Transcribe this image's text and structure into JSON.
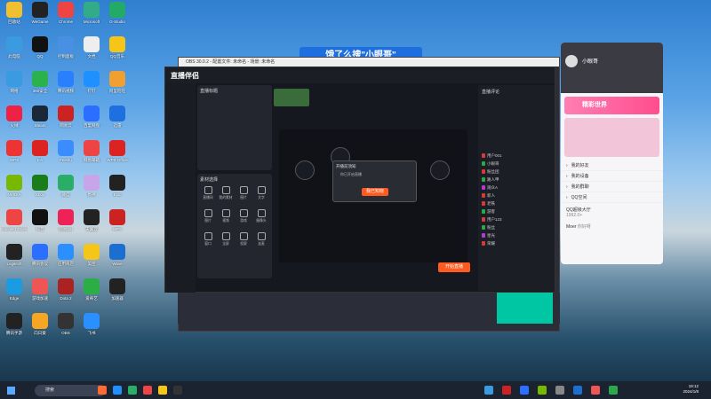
{
  "banner": {
    "text": "饿了么搜\"小眼哥\""
  },
  "desktop_icons": [
    {
      "label": "回收站",
      "color": "#f0c030"
    },
    {
      "label": "WeGame",
      "color": "#222"
    },
    {
      "label": "Chrome",
      "color": "#e44"
    },
    {
      "label": "Microsoft",
      "color": "#3a8"
    },
    {
      "label": "G-Studio",
      "color": "#2a6"
    },
    {
      "label": "此电脑",
      "color": "#3a9be0"
    },
    {
      "label": "QQ",
      "color": "#111"
    },
    {
      "label": "控制面板",
      "color": "#4a90e2"
    },
    {
      "label": "文档",
      "color": "#eee"
    },
    {
      "label": "QQ音乐",
      "color": "#f5c518"
    },
    {
      "label": "网络",
      "color": "#3a9be0"
    },
    {
      "label": "360安全",
      "color": "#2bb24c"
    },
    {
      "label": "腾讯视频",
      "color": "#2a7fff"
    },
    {
      "label": "钉钉",
      "color": "#1e90ff"
    },
    {
      "label": "阿里旺旺",
      "color": "#f0a030"
    },
    {
      "label": "火绒",
      "color": "#e24"
    },
    {
      "label": "Steam",
      "color": "#1b2838"
    },
    {
      "label": "网易云",
      "color": "#c22"
    },
    {
      "label": "百度网盘",
      "color": "#2a6fff"
    },
    {
      "label": "迅雷",
      "color": "#1e6fe0"
    },
    {
      "label": "WPS",
      "color": "#e33"
    },
    {
      "label": "EA",
      "color": "#d22"
    },
    {
      "label": "Feishu",
      "color": "#3a8cff"
    },
    {
      "label": "网易邮箱",
      "color": "#e44"
    },
    {
      "label": "WPS Office",
      "color": "#d22"
    },
    {
      "label": "NVIDIA",
      "color": "#76b900"
    },
    {
      "label": "Xbox",
      "color": "#1a7d1a"
    },
    {
      "label": "微信",
      "color": "#2aae67"
    },
    {
      "label": "原神",
      "color": "#c8a4e8"
    },
    {
      "label": "Epic",
      "color": "#222"
    },
    {
      "label": "Google Chrome",
      "color": "#e44"
    },
    {
      "label": "抖音",
      "color": "#111"
    },
    {
      "label": "网易UU",
      "color": "#e25"
    },
    {
      "label": "天翼云",
      "color": "#222"
    },
    {
      "label": "WPS",
      "color": "#c22"
    },
    {
      "label": "Logitech",
      "color": "#222"
    },
    {
      "label": "腾讯会议",
      "color": "#2a6fff"
    },
    {
      "label": "应用商店",
      "color": "#2a8fff"
    },
    {
      "label": "美团",
      "color": "#f5c518"
    },
    {
      "label": "Wave",
      "color": "#1b6fd0"
    },
    {
      "label": "Edge",
      "color": "#1b9be0"
    },
    {
      "label": "游戏加速",
      "color": "#e55"
    },
    {
      "label": "Dota 2",
      "color": "#a22"
    },
    {
      "label": "爱奇艺",
      "color": "#2aae45"
    },
    {
      "label": "加速器",
      "color": "#222"
    },
    {
      "label": "腾讯手游",
      "color": "#222"
    },
    {
      "label": "向日葵",
      "color": "#f5a623"
    },
    {
      "label": "OBS",
      "color": "#333"
    },
    {
      "label": "飞书",
      "color": "#2a8fff"
    }
  ],
  "app": {
    "title": "直播伴侣",
    "room_title": "直播标题",
    "tools_title": "素材选择",
    "tools": [
      "直播间",
      "我的素材",
      "图片",
      "文字",
      "图片",
      "视频",
      "游戏",
      "摄像头",
      "窗口",
      "全屏",
      "投屏",
      "连麦"
    ],
    "dialog": {
      "title": "开播前须知",
      "line1": "你已开启直播",
      "button": "我已知晓"
    },
    "start_button": "开始直播",
    "chat_title": "直播评论",
    "chat_users": [
      "用户001",
      "小眼哥",
      "粉丝团",
      "路人甲",
      "观众A",
      "新人",
      "老铁",
      "游客",
      "用户123",
      "粉丝",
      "星光",
      "荣耀"
    ]
  },
  "qq": {
    "name": "小眼哥",
    "banner": "精彩世界",
    "list": [
      "我的好友",
      "我的设备",
      "我的群聊",
      "QQ空间"
    ],
    "promo_title": "QQ超级大厅",
    "promo_sub": "1992.0+",
    "msg_name": "Moer",
    "msg_text": "你好呀"
  },
  "taskbar": {
    "search_placeholder": "搜索",
    "time": "19:12",
    "date": "2024/1/8"
  },
  "obs": {
    "title": "OBS 30.0.2 - 配置文件: 未命名 - 场景: 未命名"
  }
}
